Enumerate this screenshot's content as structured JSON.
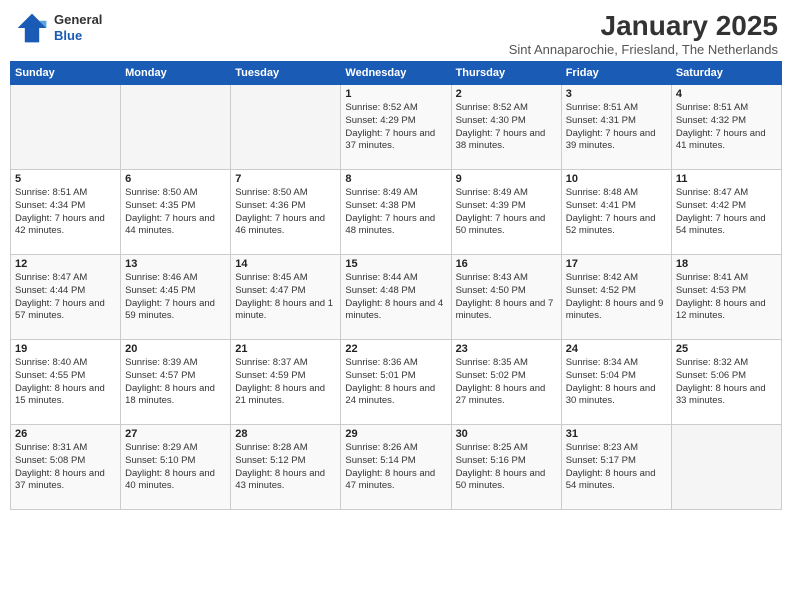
{
  "header": {
    "logo_general": "General",
    "logo_blue": "Blue",
    "month_title": "January 2025",
    "subtitle": "Sint Annaparochie, Friesland, The Netherlands"
  },
  "weekdays": [
    "Sunday",
    "Monday",
    "Tuesday",
    "Wednesday",
    "Thursday",
    "Friday",
    "Saturday"
  ],
  "weeks": [
    [
      {
        "day": "",
        "info": ""
      },
      {
        "day": "",
        "info": ""
      },
      {
        "day": "",
        "info": ""
      },
      {
        "day": "1",
        "info": "Sunrise: 8:52 AM\nSunset: 4:29 PM\nDaylight: 7 hours and 37 minutes."
      },
      {
        "day": "2",
        "info": "Sunrise: 8:52 AM\nSunset: 4:30 PM\nDaylight: 7 hours and 38 minutes."
      },
      {
        "day": "3",
        "info": "Sunrise: 8:51 AM\nSunset: 4:31 PM\nDaylight: 7 hours and 39 minutes."
      },
      {
        "day": "4",
        "info": "Sunrise: 8:51 AM\nSunset: 4:32 PM\nDaylight: 7 hours and 41 minutes."
      }
    ],
    [
      {
        "day": "5",
        "info": "Sunrise: 8:51 AM\nSunset: 4:34 PM\nDaylight: 7 hours and 42 minutes."
      },
      {
        "day": "6",
        "info": "Sunrise: 8:50 AM\nSunset: 4:35 PM\nDaylight: 7 hours and 44 minutes."
      },
      {
        "day": "7",
        "info": "Sunrise: 8:50 AM\nSunset: 4:36 PM\nDaylight: 7 hours and 46 minutes."
      },
      {
        "day": "8",
        "info": "Sunrise: 8:49 AM\nSunset: 4:38 PM\nDaylight: 7 hours and 48 minutes."
      },
      {
        "day": "9",
        "info": "Sunrise: 8:49 AM\nSunset: 4:39 PM\nDaylight: 7 hours and 50 minutes."
      },
      {
        "day": "10",
        "info": "Sunrise: 8:48 AM\nSunset: 4:41 PM\nDaylight: 7 hours and 52 minutes."
      },
      {
        "day": "11",
        "info": "Sunrise: 8:47 AM\nSunset: 4:42 PM\nDaylight: 7 hours and 54 minutes."
      }
    ],
    [
      {
        "day": "12",
        "info": "Sunrise: 8:47 AM\nSunset: 4:44 PM\nDaylight: 7 hours and 57 minutes."
      },
      {
        "day": "13",
        "info": "Sunrise: 8:46 AM\nSunset: 4:45 PM\nDaylight: 7 hours and 59 minutes."
      },
      {
        "day": "14",
        "info": "Sunrise: 8:45 AM\nSunset: 4:47 PM\nDaylight: 8 hours and 1 minute."
      },
      {
        "day": "15",
        "info": "Sunrise: 8:44 AM\nSunset: 4:48 PM\nDaylight: 8 hours and 4 minutes."
      },
      {
        "day": "16",
        "info": "Sunrise: 8:43 AM\nSunset: 4:50 PM\nDaylight: 8 hours and 7 minutes."
      },
      {
        "day": "17",
        "info": "Sunrise: 8:42 AM\nSunset: 4:52 PM\nDaylight: 8 hours and 9 minutes."
      },
      {
        "day": "18",
        "info": "Sunrise: 8:41 AM\nSunset: 4:53 PM\nDaylight: 8 hours and 12 minutes."
      }
    ],
    [
      {
        "day": "19",
        "info": "Sunrise: 8:40 AM\nSunset: 4:55 PM\nDaylight: 8 hours and 15 minutes."
      },
      {
        "day": "20",
        "info": "Sunrise: 8:39 AM\nSunset: 4:57 PM\nDaylight: 8 hours and 18 minutes."
      },
      {
        "day": "21",
        "info": "Sunrise: 8:37 AM\nSunset: 4:59 PM\nDaylight: 8 hours and 21 minutes."
      },
      {
        "day": "22",
        "info": "Sunrise: 8:36 AM\nSunset: 5:01 PM\nDaylight: 8 hours and 24 minutes."
      },
      {
        "day": "23",
        "info": "Sunrise: 8:35 AM\nSunset: 5:02 PM\nDaylight: 8 hours and 27 minutes."
      },
      {
        "day": "24",
        "info": "Sunrise: 8:34 AM\nSunset: 5:04 PM\nDaylight: 8 hours and 30 minutes."
      },
      {
        "day": "25",
        "info": "Sunrise: 8:32 AM\nSunset: 5:06 PM\nDaylight: 8 hours and 33 minutes."
      }
    ],
    [
      {
        "day": "26",
        "info": "Sunrise: 8:31 AM\nSunset: 5:08 PM\nDaylight: 8 hours and 37 minutes."
      },
      {
        "day": "27",
        "info": "Sunrise: 8:29 AM\nSunset: 5:10 PM\nDaylight: 8 hours and 40 minutes."
      },
      {
        "day": "28",
        "info": "Sunrise: 8:28 AM\nSunset: 5:12 PM\nDaylight: 8 hours and 43 minutes."
      },
      {
        "day": "29",
        "info": "Sunrise: 8:26 AM\nSunset: 5:14 PM\nDaylight: 8 hours and 47 minutes."
      },
      {
        "day": "30",
        "info": "Sunrise: 8:25 AM\nSunset: 5:16 PM\nDaylight: 8 hours and 50 minutes."
      },
      {
        "day": "31",
        "info": "Sunrise: 8:23 AM\nSunset: 5:17 PM\nDaylight: 8 hours and 54 minutes."
      },
      {
        "day": "",
        "info": ""
      }
    ]
  ]
}
